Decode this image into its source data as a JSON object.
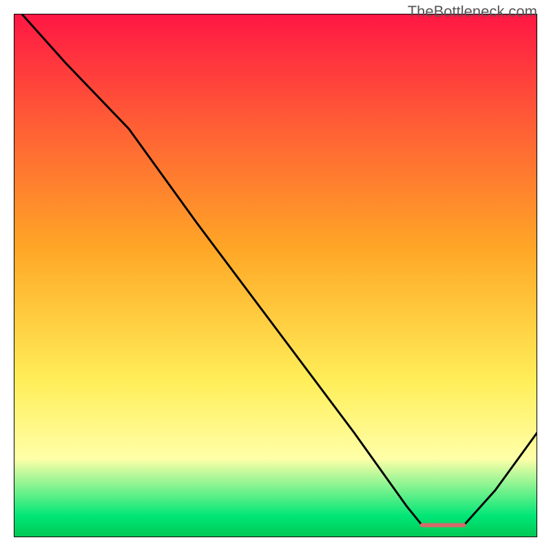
{
  "watermark": "TheBottleneck.com",
  "chart_data": {
    "type": "line",
    "title": "",
    "xlabel": "",
    "ylabel": "",
    "xlim": [
      0,
      100
    ],
    "ylim": [
      0,
      100
    ],
    "gradient_stops": [
      {
        "offset": 0,
        "color": "#ff1744"
      },
      {
        "offset": 20,
        "color": "#ff5a36"
      },
      {
        "offset": 45,
        "color": "#ffa726"
      },
      {
        "offset": 70,
        "color": "#ffee58"
      },
      {
        "offset": 85,
        "color": "#ffffa8"
      },
      {
        "offset": 96,
        "color": "#00e676"
      },
      {
        "offset": 100,
        "color": "#00c853"
      }
    ],
    "series": [
      {
        "name": "curve",
        "color": "#000000",
        "points": [
          {
            "x": 1.5,
            "y": 100
          },
          {
            "x": 10,
            "y": 90.5
          },
          {
            "x": 22,
            "y": 78
          },
          {
            "x": 35,
            "y": 60
          },
          {
            "x": 50,
            "y": 40
          },
          {
            "x": 65,
            "y": 20
          },
          {
            "x": 75,
            "y": 6
          },
          {
            "x": 78,
            "y": 2.3
          },
          {
            "x": 86,
            "y": 2.3
          },
          {
            "x": 92,
            "y": 9
          },
          {
            "x": 100,
            "y": 20
          }
        ]
      }
    ],
    "marker": {
      "name": "flat-segment-marker",
      "x1": 78,
      "x2": 86,
      "y": 2.3,
      "color": "#d46a6a",
      "thickness": 6
    }
  }
}
